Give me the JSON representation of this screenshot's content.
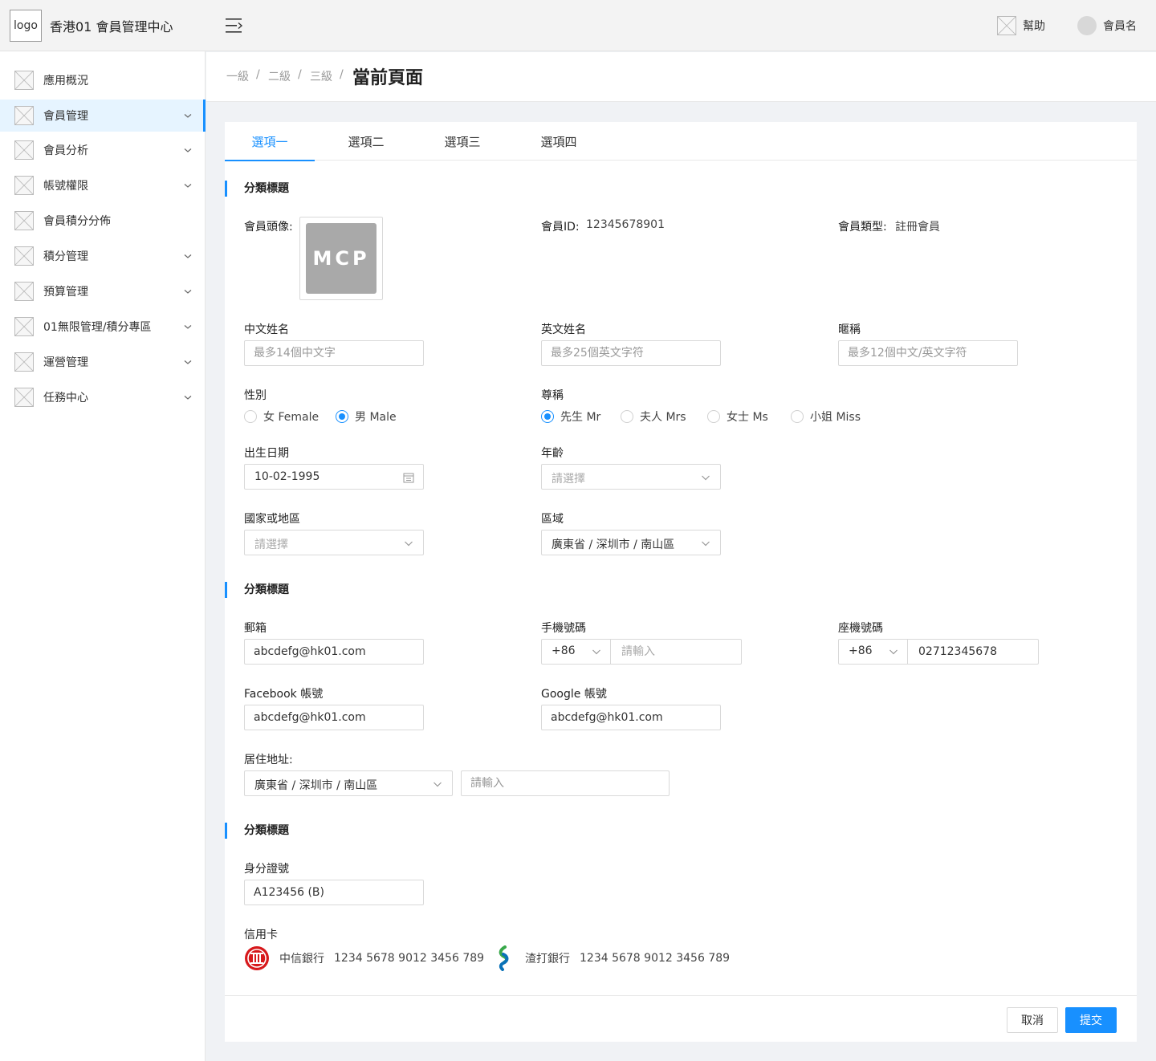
{
  "header": {
    "logo_text": "logo",
    "app_title": "香港01 會員管理中心",
    "help_label": "幫助",
    "user_name": "會員名"
  },
  "sidebar": {
    "items": [
      {
        "label": "應用概況",
        "has_children": false
      },
      {
        "label": "會員管理",
        "has_children": true,
        "active": true
      },
      {
        "label": "會員分析",
        "has_children": true
      },
      {
        "label": "帳號權限",
        "has_children": true
      },
      {
        "label": "會員積分分佈",
        "has_children": false
      },
      {
        "label": "積分管理",
        "has_children": true
      },
      {
        "label": "預算管理",
        "has_children": true
      },
      {
        "label": "01無限管理/積分專區",
        "has_children": true
      },
      {
        "label": "運營管理",
        "has_children": true
      },
      {
        "label": "任務中心",
        "has_children": true
      }
    ]
  },
  "breadcrumb": {
    "levels": [
      "一級",
      "二級",
      "三級"
    ],
    "separator": "/",
    "current": "當前頁面"
  },
  "tabs": [
    "選項一",
    "選項二",
    "選項三",
    "選項四"
  ],
  "section1": {
    "title": "分類標題",
    "avatar_label": "會員頭像:",
    "avatar_text": "MCP",
    "member_id_label": "會員ID:",
    "member_id": "12345678901",
    "member_type_label": "會員類型:",
    "member_type": "註冊會員",
    "chinese_name_label": "中文姓名",
    "chinese_name_placeholder": "最多14個中文字",
    "english_name_label": "英文姓名",
    "english_name_placeholder": "最多25個英文字符",
    "nickname_label": "暱稱",
    "nickname_placeholder": "最多12個中文/英文字符",
    "gender_label": "性別",
    "gender_options": [
      "女 Female",
      "男 Male"
    ],
    "gender_selected": 1,
    "title_label": "尊稱",
    "title_options": [
      "先生 Mr",
      "夫人 Mrs",
      "女士 Ms",
      "小姐 Miss"
    ],
    "title_selected": 0,
    "dob_label": "出生日期",
    "dob_value": "10-02-1995",
    "age_label": "年齡",
    "age_placeholder": "請選擇",
    "country_label": "國家或地區",
    "country_placeholder": "請選擇",
    "region_label": "區域",
    "region_value": "廣東省 / 深圳市 / 南山區"
  },
  "section2": {
    "title": "分類標題",
    "email_label": "郵箱",
    "email_value": "abcdefg@hk01.com",
    "mobile_label": "手機號碼",
    "mobile_code": "+86",
    "mobile_placeholder": "請輸入",
    "landline_label": "座機號碼",
    "landline_code": "+86",
    "landline_value": "02712345678",
    "facebook_label": "Facebook 帳號",
    "facebook_value": "abcdefg@hk01.com",
    "google_label": "Google 帳號",
    "google_value": "abcdefg@hk01.com",
    "address_label": "居住地址:",
    "address_region": "廣東省 / 深圳市 / 南山區",
    "address_placeholder": "請輸入"
  },
  "section3": {
    "title": "分類標題",
    "id_label": "身分證號",
    "id_value": "A123456 (B)",
    "credit_card_label": "信用卡",
    "cards": [
      {
        "bank": "中信銀行",
        "number": "1234 5678 9012 3456 789",
        "icon": "citic-bank-logo"
      },
      {
        "bank": "渣打銀行",
        "number": "1234 5678 9012 3456 789",
        "icon": "standard-chartered-logo"
      }
    ]
  },
  "footer": {
    "cancel_label": "取消",
    "submit_label": "提交"
  },
  "colors": {
    "primary": "#1890ff",
    "citic_red": "#d7191c",
    "sc_green": "#38a84a",
    "sc_blue": "#0a72b8"
  }
}
